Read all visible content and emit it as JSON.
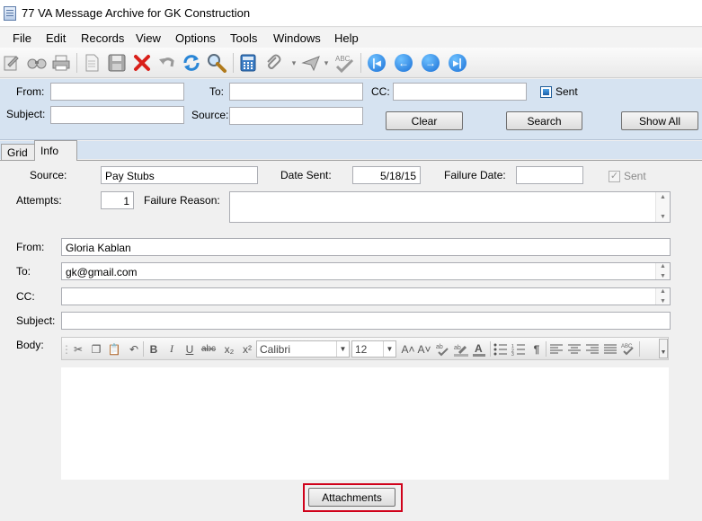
{
  "window": {
    "title": "77 VA Message Archive for GK Construction"
  },
  "menu": [
    "File",
    "Edit",
    "Records",
    "View",
    "Options",
    "Tools",
    "Windows",
    "Help"
  ],
  "toolbar": {
    "icons": [
      "new-record-icon",
      "find-icon",
      "print-icon",
      "document-icon",
      "save-icon",
      "delete-icon",
      "undo-icon",
      "refresh-icon",
      "search-icon",
      "calculator-icon",
      "attach-icon",
      "send-icon",
      "spell-check-icon",
      "first-record-icon",
      "previous-record-icon",
      "next-record-icon",
      "last-record-icon"
    ]
  },
  "search": {
    "from_label": "From:",
    "to_label": "To:",
    "cc_label": "CC:",
    "sent_label": "Sent",
    "sent_checked": true,
    "subject_label": "Subject:",
    "source_label": "Source:",
    "from_value": "",
    "to_value": "",
    "cc_value": "",
    "subject_value": "",
    "source_value": "",
    "clear_label": "Clear",
    "search_label": "Search",
    "show_all_label": "Show All"
  },
  "tabs": {
    "grid": "Grid",
    "info": "Info"
  },
  "info": {
    "source_label": "Source:",
    "source_value": "Pay Stubs",
    "date_sent_label": "Date Sent:",
    "date_sent_value": "5/18/15",
    "failure_date_label": "Failure Date:",
    "failure_date_value": "",
    "sent_label": "Sent",
    "sent_checked": true,
    "attempts_label": "Attempts:",
    "attempts_value": "1",
    "failure_reason_label": "Failure Reason:",
    "failure_reason_value": "",
    "from_label": "From:",
    "from_value": "Gloria Kablan",
    "to_label": "To:",
    "to_value": "gk@gmail.com",
    "cc_label": "CC:",
    "cc_value": "",
    "subject_label": "Subject:",
    "subject_value": "",
    "body_label": "Body:",
    "body_value": ""
  },
  "editor": {
    "font_name": "Calibri",
    "font_size": "12",
    "icons": [
      "cut-icon",
      "copy-icon",
      "paste-icon",
      "undo-icon",
      "bold-icon",
      "italic-icon",
      "underline-icon",
      "strikethrough-icon",
      "subscript-icon",
      "superscript-icon",
      "grow-font-icon",
      "shrink-font-icon",
      "spelling-icon",
      "highlight-icon",
      "font-color-icon",
      "bullets-icon",
      "numbering-icon",
      "paragraph-icon",
      "align-left-icon",
      "align-center-icon",
      "align-right-icon",
      "justify-icon",
      "spell-check-icon"
    ],
    "glyphs": {
      "bold": "B",
      "italic": "I",
      "underline": "U",
      "strike": "abc",
      "sub": "x₂",
      "sup": "x²",
      "grow": "A˄",
      "shrink": "A˅",
      "paragraph": "¶"
    }
  },
  "attachments_label": "Attachments"
}
